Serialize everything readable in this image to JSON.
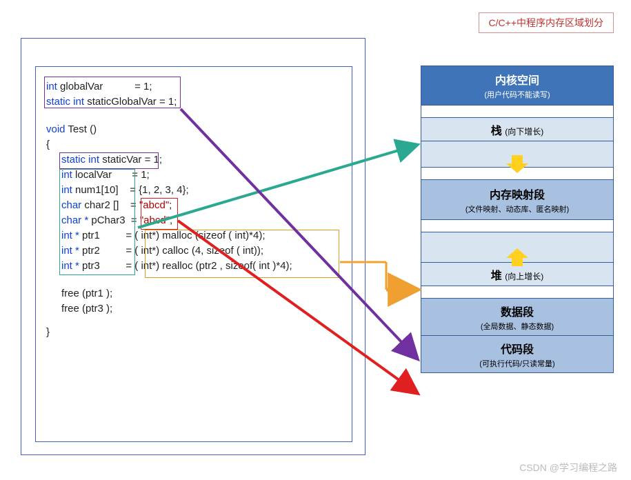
{
  "diagram_title": "C/C++中程序内存区域划分",
  "code": {
    "l1_kw": "int ",
    "l1_name": "globalVar",
    "l1_rest": "           = 1;",
    "l2_kw": "static int ",
    "l2_name": "staticGlobalVar",
    "l2_rest": " = 1;",
    "l3_kw": "void ",
    "l3_name": "Test ()",
    "l4": "{",
    "l5_kw": "static int ",
    "l5_name": "staticVar",
    "l5_rest": " = 1;",
    "l6_kw": "int ",
    "l6_name": "localVar       = 1;",
    "l7_kw": "int ",
    "l7_name": "num1[10]    = {1, 2, 3, 4};",
    "l8_kw": "char ",
    "l8_name": "char2 []    = ",
    "l8_str": "\"abcd\"",
    "l8_end": ";",
    "l9_kw": "char * ",
    "l9_name": "pChar3  = ",
    "l9_str": "\"abcd\"",
    "l9_end": ";",
    "l10_kw": "int * ",
    "l10_name": "ptr1         = ( int*) malloc (sizeof ( int)*4);",
    "l11_kw": "int * ",
    "l11_name": "ptr2         = ( int*) calloc (4, sizeof ( int));",
    "l12_kw": "int * ",
    "l12_name": "ptr3         = ( int*) realloc (ptr2 , sizeof( int )*4);",
    "l13": "free (ptr1 );",
    "l14": "free (ptr3 );",
    "l15": "}"
  },
  "memory": {
    "r1_title": "内核空间",
    "r1_sub": "(用户代码不能读写)",
    "r2_title": "栈 ",
    "r2_sub": "(向下增长)",
    "r4_title": "内存映射段",
    "r4_sub": "(文件映射、动态库、匿名映射)",
    "r6_title": "堆 ",
    "r6_sub": "(向上增长)",
    "r7_title": "数据段",
    "r7_sub": "(全局数据、静态数据)",
    "r8_title": "代码段",
    "r8_sub": "(可执行代码/只读常量)"
  },
  "watermark": "CSDN @学习编程之路"
}
